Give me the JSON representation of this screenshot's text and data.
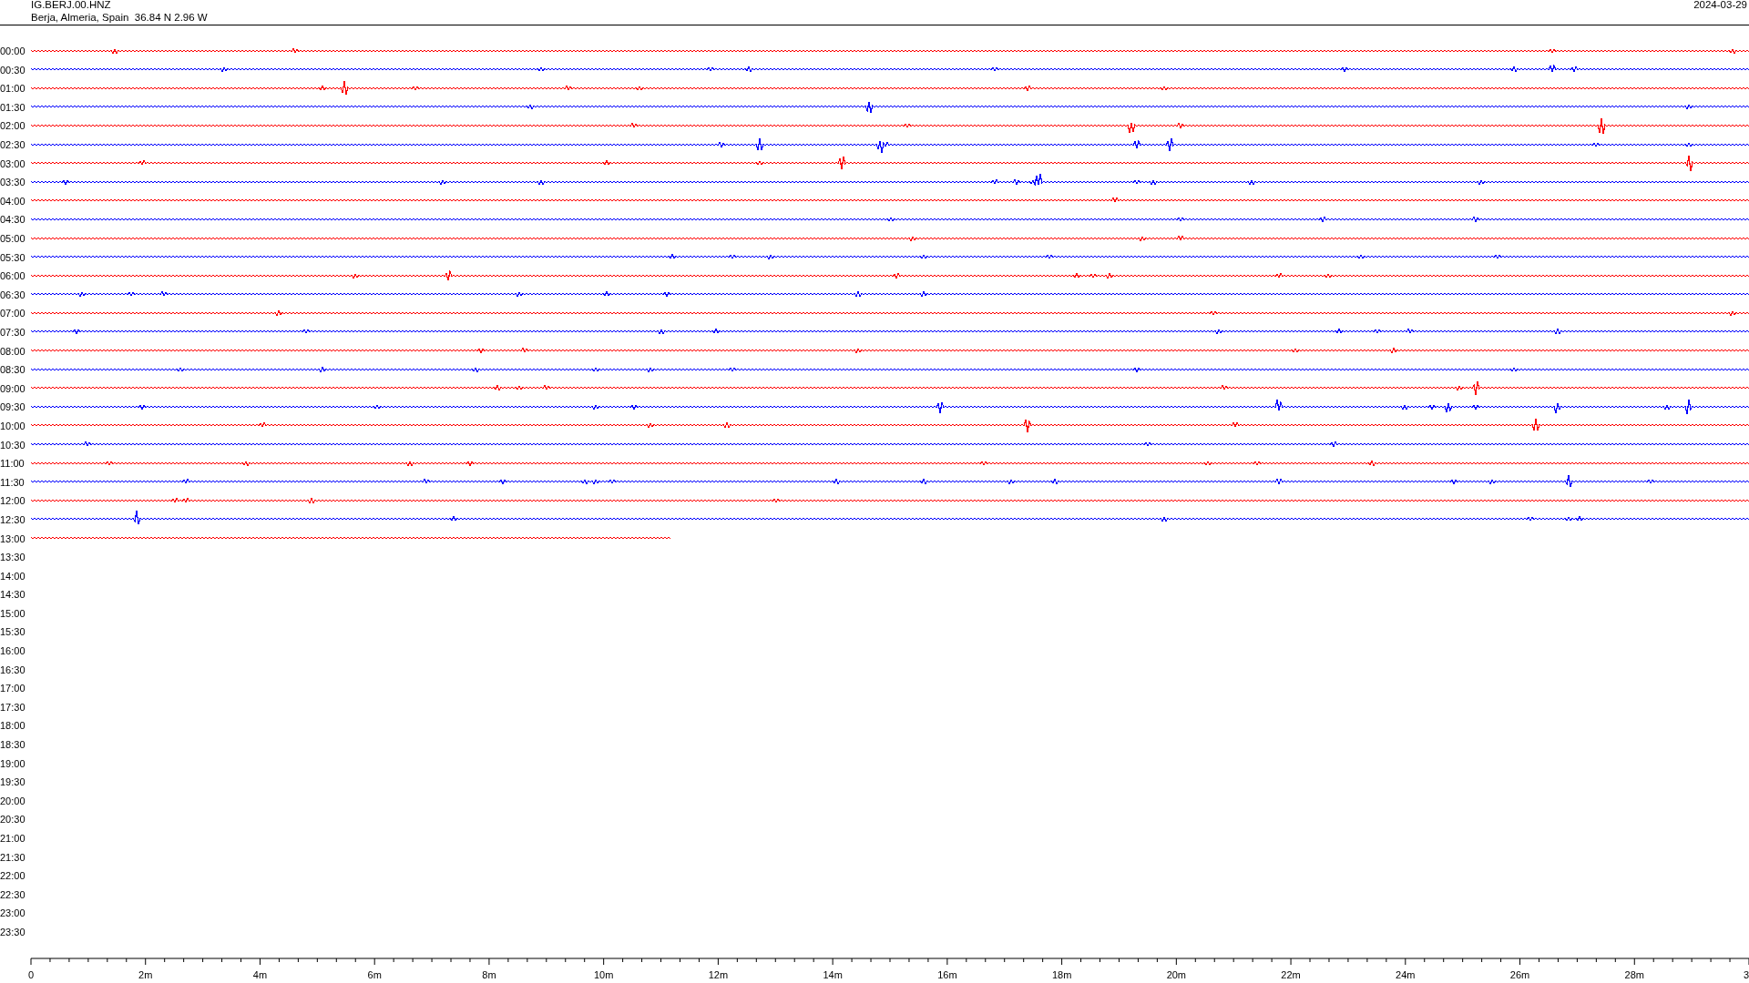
{
  "header": {
    "station": "IG.BERJ.00.HNZ",
    "location": "Berja, Almeria, Spain  36.84 N 2.96 W",
    "date": "2024-03-29"
  },
  "rows": [
    {
      "label": "00:00",
      "color": "#ff0000",
      "level": 1
    },
    {
      "label": "00:30",
      "color": "#0000ff",
      "level": 1
    },
    {
      "label": "01:00",
      "color": "#ff0000",
      "level": 1
    },
    {
      "label": "01:30",
      "color": "#0000ff",
      "level": 1
    },
    {
      "label": "02:00",
      "color": "#ff0000",
      "level": 1
    },
    {
      "label": "02:30",
      "color": "#0000ff",
      "level": 1
    },
    {
      "label": "03:00",
      "color": "#ff0000",
      "level": 1
    },
    {
      "label": "03:30",
      "color": "#0000ff",
      "level": 1
    },
    {
      "label": "04:00",
      "color": "#ff0000",
      "level": 1
    },
    {
      "label": "04:30",
      "color": "#0000ff",
      "level": 1
    },
    {
      "label": "05:00",
      "color": "#ff0000",
      "level": 1
    },
    {
      "label": "05:30",
      "color": "#0000ff",
      "level": 1
    },
    {
      "label": "06:00",
      "color": "#ff0000",
      "level": 1
    },
    {
      "label": "06:30",
      "color": "#0000ff",
      "level": 1
    },
    {
      "label": "07:00",
      "color": "#ff0000",
      "level": 1
    },
    {
      "label": "07:30",
      "color": "#0000ff",
      "level": 1
    },
    {
      "label": "08:00",
      "color": "#ff0000",
      "level": 1
    },
    {
      "label": "08:30",
      "color": "#0000ff",
      "level": 1
    },
    {
      "label": "09:00",
      "color": "#ff0000",
      "level": 1
    },
    {
      "label": "09:30",
      "color": "#0000ff",
      "level": 1
    },
    {
      "label": "10:00",
      "color": "#ff0000",
      "level": 1
    },
    {
      "label": "10:30",
      "color": "#0000ff",
      "level": 1
    },
    {
      "label": "11:00",
      "color": "#ff0000",
      "level": 1
    },
    {
      "label": "11:30",
      "color": "#0000ff",
      "level": 1
    },
    {
      "label": "12:00",
      "color": "#ff0000",
      "level": 1
    },
    {
      "label": "12:30",
      "color": "#0000ff",
      "level": 1
    },
    {
      "label": "13:00",
      "color": "#ff0000",
      "level": 0.373
    },
    {
      "label": "13:30"
    },
    {
      "label": "14:00"
    },
    {
      "label": "14:30"
    },
    {
      "label": "15:00"
    },
    {
      "label": "15:30"
    },
    {
      "label": "16:00"
    },
    {
      "label": "16:30"
    },
    {
      "label": "17:00"
    },
    {
      "label": "17:30"
    },
    {
      "label": "18:00"
    },
    {
      "label": "18:30"
    },
    {
      "label": "19:00"
    },
    {
      "label": "19:30"
    },
    {
      "label": "20:00"
    },
    {
      "label": "20:30"
    },
    {
      "label": "21:00"
    },
    {
      "label": "21:30"
    },
    {
      "label": "22:00"
    },
    {
      "label": "22:30"
    },
    {
      "label": "23:00"
    },
    {
      "label": "23:30"
    }
  ],
  "axis": {
    "tick_labels": [
      "0",
      "2m",
      "4m",
      "6m",
      "8m",
      "10m",
      "12m",
      "14m",
      "16m",
      "18m",
      "20m",
      "22m",
      "24m",
      "26m",
      "28m",
      "3"
    ]
  }
}
